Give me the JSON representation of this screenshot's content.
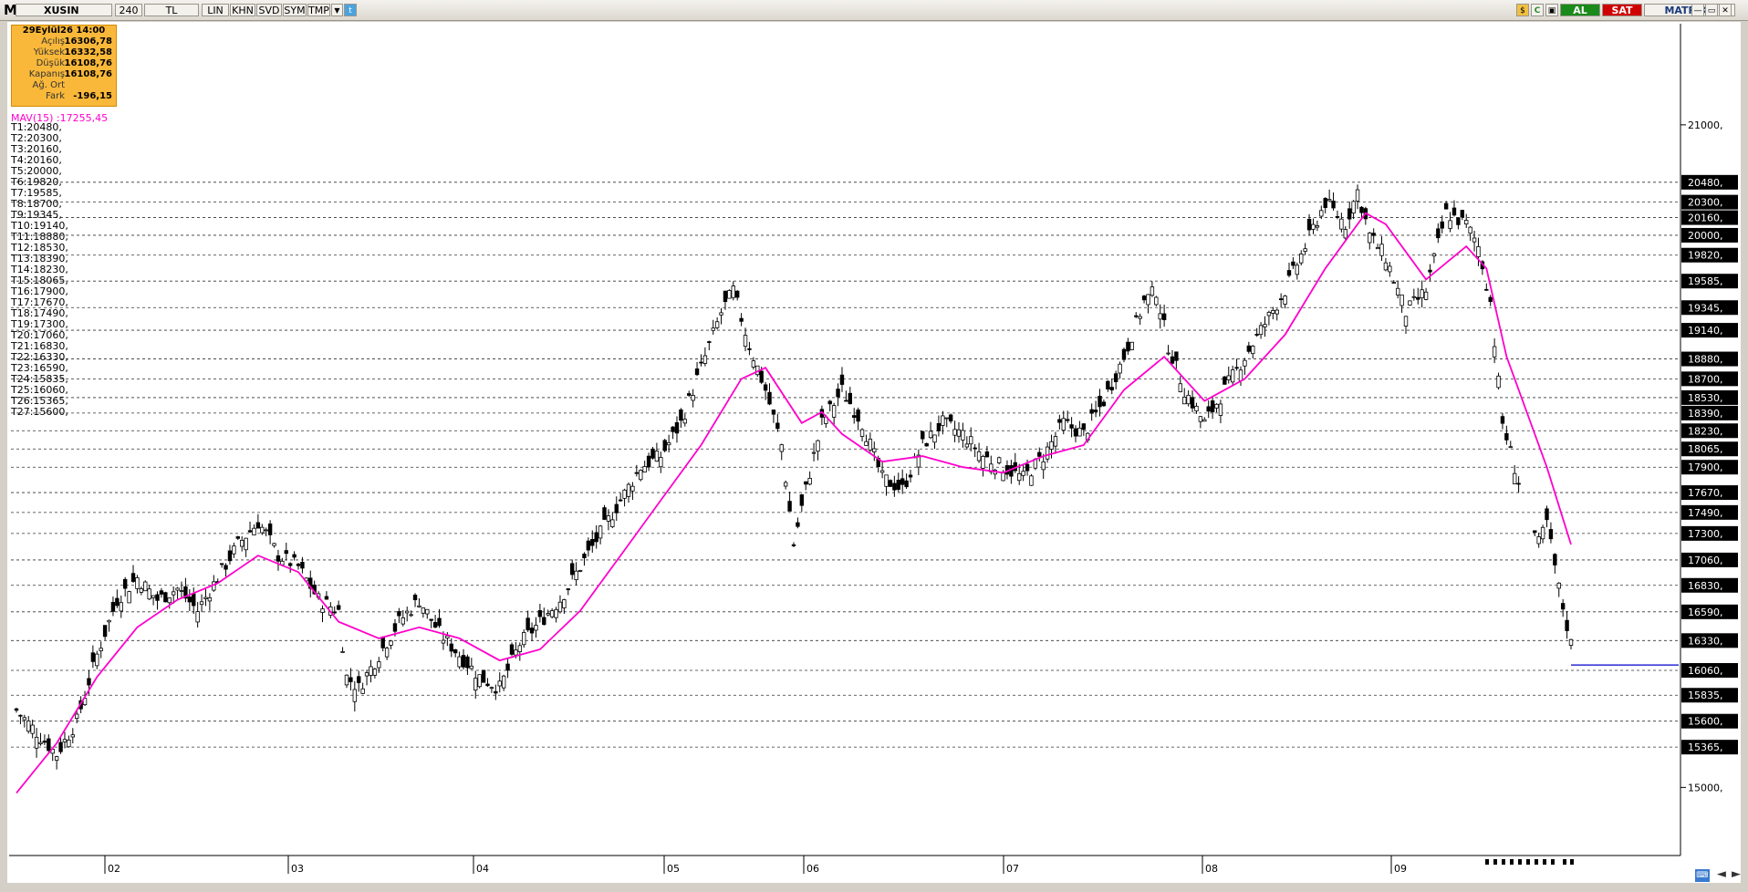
{
  "toolbar": {
    "logo": "M",
    "symbol": "XUSIN",
    "period": "240",
    "currency": "TL",
    "buttons": [
      "LIN",
      "KHN",
      "SVD",
      "SYM",
      "TMP"
    ],
    "al_label": "AL",
    "sat_label": "SAT",
    "brand": "MATRİKS",
    "colors": {
      "al_bg": "#1a8a1a",
      "sat_bg": "#d00000"
    }
  },
  "info": {
    "header": "29Eylül26 14:00",
    "rows": [
      {
        "k": "Açılış",
        "v": "16306,78"
      },
      {
        "k": "Yüksek",
        "v": "16332,58"
      },
      {
        "k": "Düşük",
        "v": "16108,76"
      },
      {
        "k": "Kapanış",
        "v": "16108,76"
      },
      {
        "k": "Ağ. Ort",
        "v": ""
      },
      {
        "k": "Fark",
        "v": "-196,15"
      }
    ]
  },
  "mav_label": "MAV(15)     :17255,45",
  "trend_levels": [
    "T1:20480,",
    "T2:20300,",
    "T3:20160,",
    "T4:20160,",
    "T5:20000,",
    "T6:19820,",
    "T7:19585,",
    "T8:18700,",
    "T9:19345,",
    "T10:19140,",
    "T11:18880,",
    "T12:18530,",
    "T13:18390,",
    "T14:18230,",
    "T15:18065,",
    "T16:17900,",
    "T17:17670,",
    "T18:17490,",
    "T19:17300,",
    "T20:17060,",
    "T21:16830,",
    "T22:16330,",
    "T23:16590,",
    "T24:15835,",
    "T25:16060,",
    "T26:15365,",
    "T27:15600,"
  ],
  "chart_data": {
    "type": "candlestick",
    "symbol": "XUSIN",
    "ylim": [
      14400,
      21800
    ],
    "y_ticks": [
      "21000,",
      "15000,"
    ],
    "x_ticks": [
      "02",
      "03",
      "04",
      "05",
      "06",
      "07",
      "08",
      "09"
    ],
    "horizontal_levels": [
      {
        "label": "20480,",
        "value": 20480
      },
      {
        "label": "20300,",
        "value": 20300
      },
      {
        "label": "20160,",
        "value": 20160
      },
      {
        "label": "20000,",
        "value": 20000
      },
      {
        "label": "19820,",
        "value": 19820
      },
      {
        "label": "19585,",
        "value": 19585
      },
      {
        "label": "19345,",
        "value": 19345
      },
      {
        "label": "19140,",
        "value": 19140
      },
      {
        "label": "18880,",
        "value": 18880
      },
      {
        "label": "18700,",
        "value": 18700
      },
      {
        "label": "18530,",
        "value": 18530
      },
      {
        "label": "18390,",
        "value": 18390
      },
      {
        "label": "18230,",
        "value": 18230
      },
      {
        "label": "18065,",
        "value": 18065
      },
      {
        "label": "17900,",
        "value": 17900
      },
      {
        "label": "17670,",
        "value": 17670
      },
      {
        "label": "17490,",
        "value": 17490
      },
      {
        "label": "17300,",
        "value": 17300
      },
      {
        "label": "17060,",
        "value": 17060
      },
      {
        "label": "16830,",
        "value": 16830
      },
      {
        "label": "16590,",
        "value": 16590
      },
      {
        "label": "16330,",
        "value": 16330
      },
      {
        "label": "16060,",
        "value": 16060
      },
      {
        "label": "15835,",
        "value": 15835
      },
      {
        "label": "15600,",
        "value": 15600
      },
      {
        "label": "15365,",
        "value": 15365
      }
    ],
    "close_path": [
      [
        0,
        15700
      ],
      [
        5,
        15500
      ],
      [
        10,
        15300
      ],
      [
        15,
        15600
      ],
      [
        20,
        16200
      ],
      [
        25,
        16700
      ],
      [
        30,
        16900
      ],
      [
        35,
        16700
      ],
      [
        40,
        16800
      ],
      [
        45,
        16600
      ],
      [
        50,
        16900
      ],
      [
        55,
        17200
      ],
      [
        60,
        17400
      ],
      [
        62,
        17300
      ],
      [
        65,
        17100
      ],
      [
        70,
        17000
      ],
      [
        75,
        16700
      ],
      [
        80,
        16600
      ],
      [
        82,
        16000
      ],
      [
        85,
        15900
      ],
      [
        90,
        16200
      ],
      [
        95,
        16500
      ],
      [
        100,
        16700
      ],
      [
        105,
        16400
      ],
      [
        110,
        16200
      ],
      [
        115,
        16000
      ],
      [
        120,
        15900
      ],
      [
        125,
        16300
      ],
      [
        130,
        16500
      ],
      [
        135,
        16700
      ],
      [
        140,
        17000
      ],
      [
        145,
        17300
      ],
      [
        150,
        17600
      ],
      [
        155,
        17900
      ],
      [
        160,
        18000
      ],
      [
        165,
        18300
      ],
      [
        170,
        18800
      ],
      [
        175,
        19300
      ],
      [
        178,
        19500
      ],
      [
        182,
        19000
      ],
      [
        186,
        18600
      ],
      [
        190,
        18100
      ],
      [
        193,
        17200
      ],
      [
        196,
        17700
      ],
      [
        200,
        18300
      ],
      [
        205,
        18600
      ],
      [
        210,
        18300
      ],
      [
        215,
        17800
      ],
      [
        220,
        17700
      ],
      [
        225,
        18100
      ],
      [
        230,
        18300
      ],
      [
        235,
        18200
      ],
      [
        240,
        18000
      ],
      [
        245,
        17900
      ],
      [
        250,
        17800
      ],
      [
        255,
        18000
      ],
      [
        260,
        18300
      ],
      [
        265,
        18200
      ],
      [
        270,
        18500
      ],
      [
        275,
        18900
      ],
      [
        280,
        19400
      ],
      [
        283,
        19500
      ],
      [
        286,
        19000
      ],
      [
        290,
        18600
      ],
      [
        295,
        18300
      ],
      [
        300,
        18600
      ],
      [
        305,
        18900
      ],
      [
        310,
        19200
      ],
      [
        315,
        19500
      ],
      [
        320,
        19900
      ],
      [
        325,
        20300
      ],
      [
        330,
        20100
      ],
      [
        333,
        20400
      ],
      [
        336,
        20000
      ],
      [
        340,
        19800
      ],
      [
        345,
        19300
      ],
      [
        350,
        19500
      ],
      [
        355,
        20200
      ],
      [
        360,
        20100
      ],
      [
        363,
        19900
      ],
      [
        366,
        19400
      ],
      [
        369,
        18300
      ],
      [
        372,
        17900
      ],
      [
        375,
        17500
      ],
      [
        378,
        17200
      ],
      [
        380,
        17400
      ],
      [
        383,
        16800
      ],
      [
        386,
        16300
      ]
    ],
    "mav_path": [
      [
        0,
        14950
      ],
      [
        10,
        15400
      ],
      [
        20,
        16000
      ],
      [
        30,
        16450
      ],
      [
        40,
        16700
      ],
      [
        50,
        16850
      ],
      [
        60,
        17100
      ],
      [
        70,
        16950
      ],
      [
        80,
        16500
      ],
      [
        90,
        16350
      ],
      [
        100,
        16450
      ],
      [
        110,
        16350
      ],
      [
        120,
        16150
      ],
      [
        130,
        16250
      ],
      [
        140,
        16600
      ],
      [
        150,
        17100
      ],
      [
        160,
        17600
      ],
      [
        170,
        18100
      ],
      [
        180,
        18700
      ],
      [
        186,
        18800
      ],
      [
        195,
        18300
      ],
      [
        200,
        18400
      ],
      [
        205,
        18200
      ],
      [
        215,
        17950
      ],
      [
        225,
        18000
      ],
      [
        235,
        17900
      ],
      [
        245,
        17850
      ],
      [
        255,
        18000
      ],
      [
        265,
        18100
      ],
      [
        275,
        18600
      ],
      [
        285,
        18900
      ],
      [
        295,
        18500
      ],
      [
        305,
        18700
      ],
      [
        315,
        19100
      ],
      [
        325,
        19700
      ],
      [
        335,
        20200
      ],
      [
        340,
        20100
      ],
      [
        350,
        19600
      ],
      [
        360,
        19900
      ],
      [
        365,
        19700
      ],
      [
        370,
        18900
      ],
      [
        380,
        17900
      ],
      [
        386,
        17200
      ]
    ],
    "last_price": 16108.76,
    "ma_color": "#ff00cc",
    "last_price_color": "#0000cc"
  },
  "status_icons": [
    "keyboard-icon",
    "arrow-left-icon",
    "arrow-right-icon"
  ]
}
